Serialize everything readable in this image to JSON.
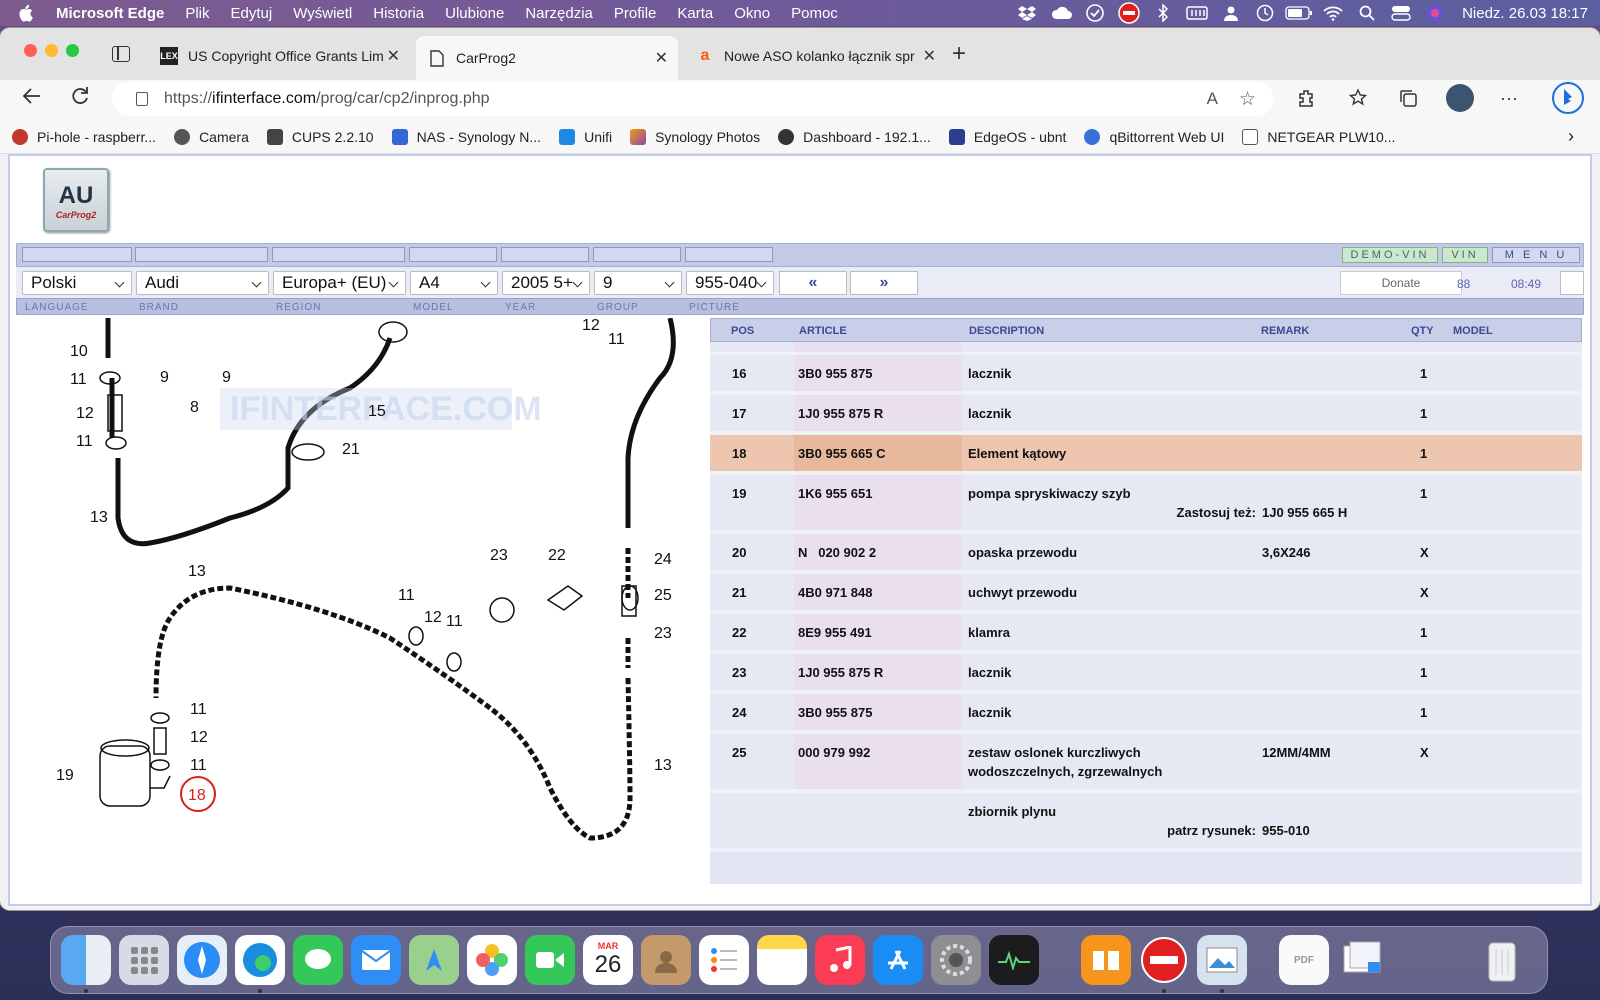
{
  "menubar": {
    "app": "Microsoft Edge",
    "items": [
      "Plik",
      "Edytuj",
      "Wyświetl",
      "Historia",
      "Ulubione",
      "Narzędzia",
      "Profile",
      "Karta",
      "Okno",
      "Pomoc"
    ],
    "datetime": "Niedz. 26.03  18:17"
  },
  "tabs": [
    {
      "title": "US Copyright Office Grants Lim",
      "icon": "lex-icon",
      "active": false
    },
    {
      "title": "CarProg2",
      "icon": "page-icon",
      "active": true
    },
    {
      "title": "Nowe ASO kolanko łącznik spr",
      "icon": "allegro-icon",
      "active": false
    }
  ],
  "address": {
    "prefix": "https://",
    "domain": "ifinterface.com",
    "path": "/prog/car/cp2/inprog.php"
  },
  "bookmarks": [
    {
      "label": "Pi-hole - raspberr...",
      "color": "#c0392b"
    },
    {
      "label": "Camera",
      "color": "#555"
    },
    {
      "label": "CUPS 2.2.10",
      "color": "#444"
    },
    {
      "label": "NAS - Synology N...",
      "color": "#3367d6"
    },
    {
      "label": "Unifi",
      "color": "#1e88e5"
    },
    {
      "label": "Synology Photos",
      "color": "#f39c12"
    },
    {
      "label": "Dashboard - 192.1...",
      "color": "#333"
    },
    {
      "label": "EdgeOS - ubnt",
      "color": "#2c3e8f"
    },
    {
      "label": "qBittorrent Web UI",
      "color": "#3a6fd8"
    },
    {
      "label": "NETGEAR PLW10...",
      "color": "#777"
    }
  ],
  "app": {
    "logo_text": "AU",
    "logo_sub": "CarProg2",
    "buttons": {
      "demo_vin": "DEMO-VIN",
      "vin": "VIN",
      "menu": "M E N U"
    },
    "selects": {
      "language": "Polski",
      "brand": "Audi",
      "region": "Europa+ (EU)",
      "model": "A4",
      "year": "2005  5+",
      "group": "9",
      "picture": "955-040"
    },
    "nav": {
      "prev": "«",
      "next": "»"
    },
    "donate": "Donate",
    "count": "88",
    "time": "08:49",
    "labels": {
      "language": "LANGUAGE",
      "brand": "BRAND",
      "region": "REGION",
      "model": "MODEL",
      "year": "YEAR",
      "group": "GROUP",
      "picture": "PICTURE"
    },
    "watermark": "IFINTERFACE.COM"
  },
  "table": {
    "headers": {
      "pos": "POS",
      "article": "ARTICLE",
      "description": "DESCRIPTION",
      "remark": "REMARK",
      "qty": "QTY",
      "model": "MODEL"
    },
    "rows": [
      {
        "pos": "16",
        "article": "3B0 955 875",
        "desc": "lacznik",
        "remark": "",
        "qty": "1"
      },
      {
        "pos": "17",
        "article": "1J0 955 875 R",
        "desc": "lacznik",
        "remark": "",
        "qty": "1"
      },
      {
        "pos": "18",
        "article": "3B0 955 665 C",
        "desc": "Element kątowy",
        "remark": "",
        "qty": "1"
      },
      {
        "pos": "19",
        "article": "1K6 955 651",
        "desc": "pompa spryskiwaczy szyb",
        "remark": "",
        "qty": "1",
        "note_label": "Zastosuj też:",
        "note_value": "1J0 955 665 H"
      },
      {
        "pos": "20",
        "article": "N   020 902 2",
        "desc": "opaska przewodu",
        "remark": "3,6X246",
        "qty": "X"
      },
      {
        "pos": "21",
        "article": "4B0 971 848",
        "desc": "uchwyt przewodu",
        "remark": "",
        "qty": "X"
      },
      {
        "pos": "22",
        "article": "8E9 955 491",
        "desc": "klamra",
        "remark": "",
        "qty": "1"
      },
      {
        "pos": "23",
        "article": "1J0 955 875 R",
        "desc": "lacznik",
        "remark": "",
        "qty": "1"
      },
      {
        "pos": "24",
        "article": "3B0 955 875",
        "desc": "lacznik",
        "remark": "",
        "qty": "1"
      },
      {
        "pos": "25",
        "article": "000 979 992",
        "desc": "zestaw oslonek kurczliwych",
        "desc2": "wodoszczelnych, zgrzewalnych",
        "remark": "12MM/4MM",
        "qty": "X"
      },
      {
        "pos": "",
        "article": "",
        "desc": "zbiornik plynu",
        "remark": "",
        "qty": "",
        "note_label": "patrz rysunek:",
        "note_value": "955-010"
      }
    ]
  },
  "diagram_labels": [
    "10",
    "11",
    "12",
    "11",
    "13",
    "9",
    "9",
    "8",
    "15",
    "21",
    "12",
    "11",
    "13",
    "11",
    "12",
    "11",
    "23",
    "22",
    "24",
    "25",
    "23",
    "11",
    "12",
    "11",
    "19",
    "18",
    "13"
  ],
  "dock": {
    "calendar_month": "MAR",
    "calendar_day": "26"
  }
}
